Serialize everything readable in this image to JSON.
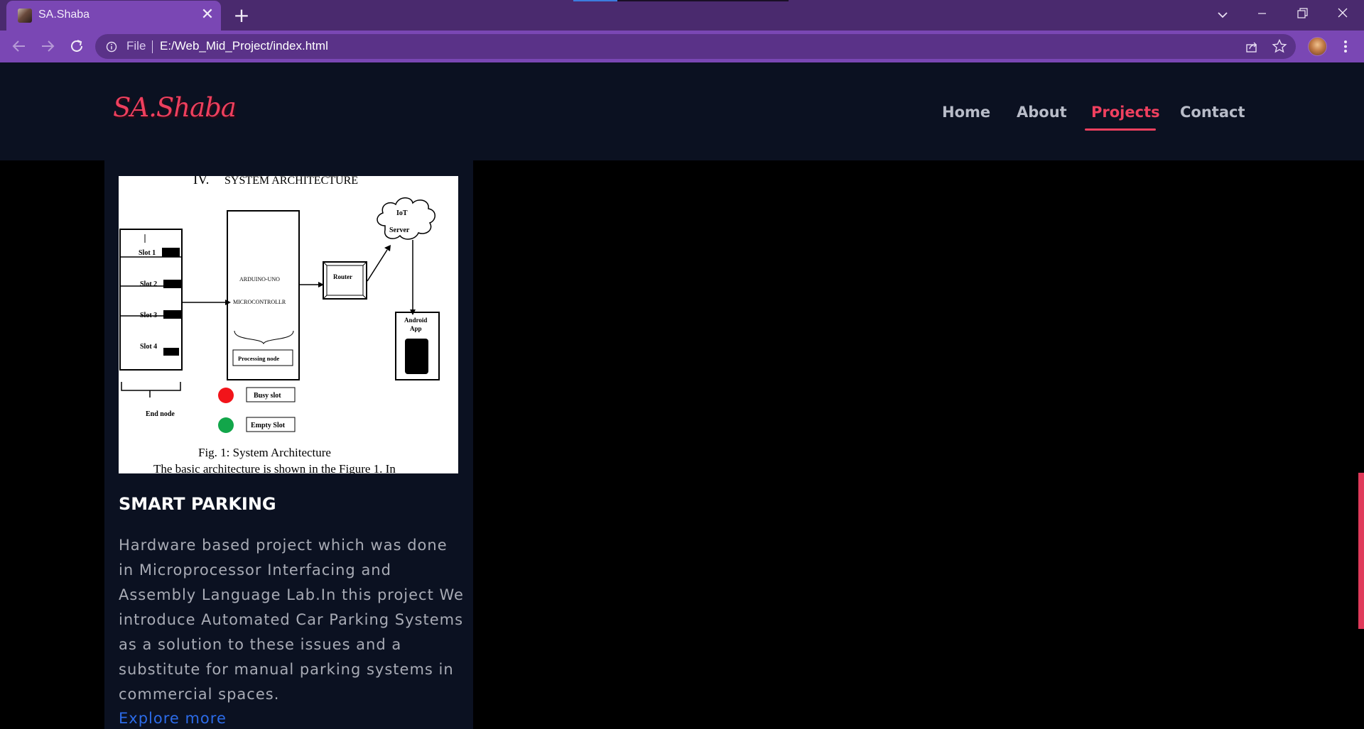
{
  "browser": {
    "tab": {
      "title": "SA.Shaba"
    },
    "address": {
      "scheme_label": "File",
      "url": "E:/Web_Mid_Project/index.html"
    },
    "icons": [
      "back-icon",
      "forward-icon",
      "reload-icon",
      "info-icon",
      "share-icon",
      "star-icon",
      "profile-avatar",
      "menu-icon",
      "tab-search-icon",
      "minimize-icon",
      "restore-icon",
      "close-icon"
    ]
  },
  "site": {
    "logo": "SA.Shaba",
    "nav": [
      {
        "label": "Home",
        "active": false
      },
      {
        "label": "About",
        "active": false
      },
      {
        "label": "Projects",
        "active": true
      },
      {
        "label": "Contact",
        "active": false
      }
    ],
    "accent_color": "#f0405f"
  },
  "project": {
    "figure": {
      "heading_numeral": "IV.",
      "heading_text": "SYSTEM ARCHITECTURE",
      "slots": [
        "Slot 1",
        "Slot 2",
        "Slot 3",
        "Slot 4"
      ],
      "controller_line1": "ARDUINO-UNO",
      "controller_line2": "MICROCONTROLLR",
      "processing_node": "Processing node",
      "router": "Router",
      "cloud_line1": "IoT",
      "cloud_line2": "Server",
      "app_line1": "Android",
      "app_line2": "App",
      "end_node": "End node",
      "busy_slot": "Busy slot",
      "empty_slot": "Empty Slot",
      "caption": "Fig. 1: System Architecture",
      "body_text": "The basic architecture is shown in the Figure 1. In"
    },
    "title": "SMART PARKING",
    "description": "Hardware based project which was done in Microprocessor Interfacing and Assembly Language Lab.In this project We introduce Automated Car Parking Systems as a solution to these issues and a substitute for manual parking systems in commercial spaces.",
    "link": "Explore more"
  }
}
